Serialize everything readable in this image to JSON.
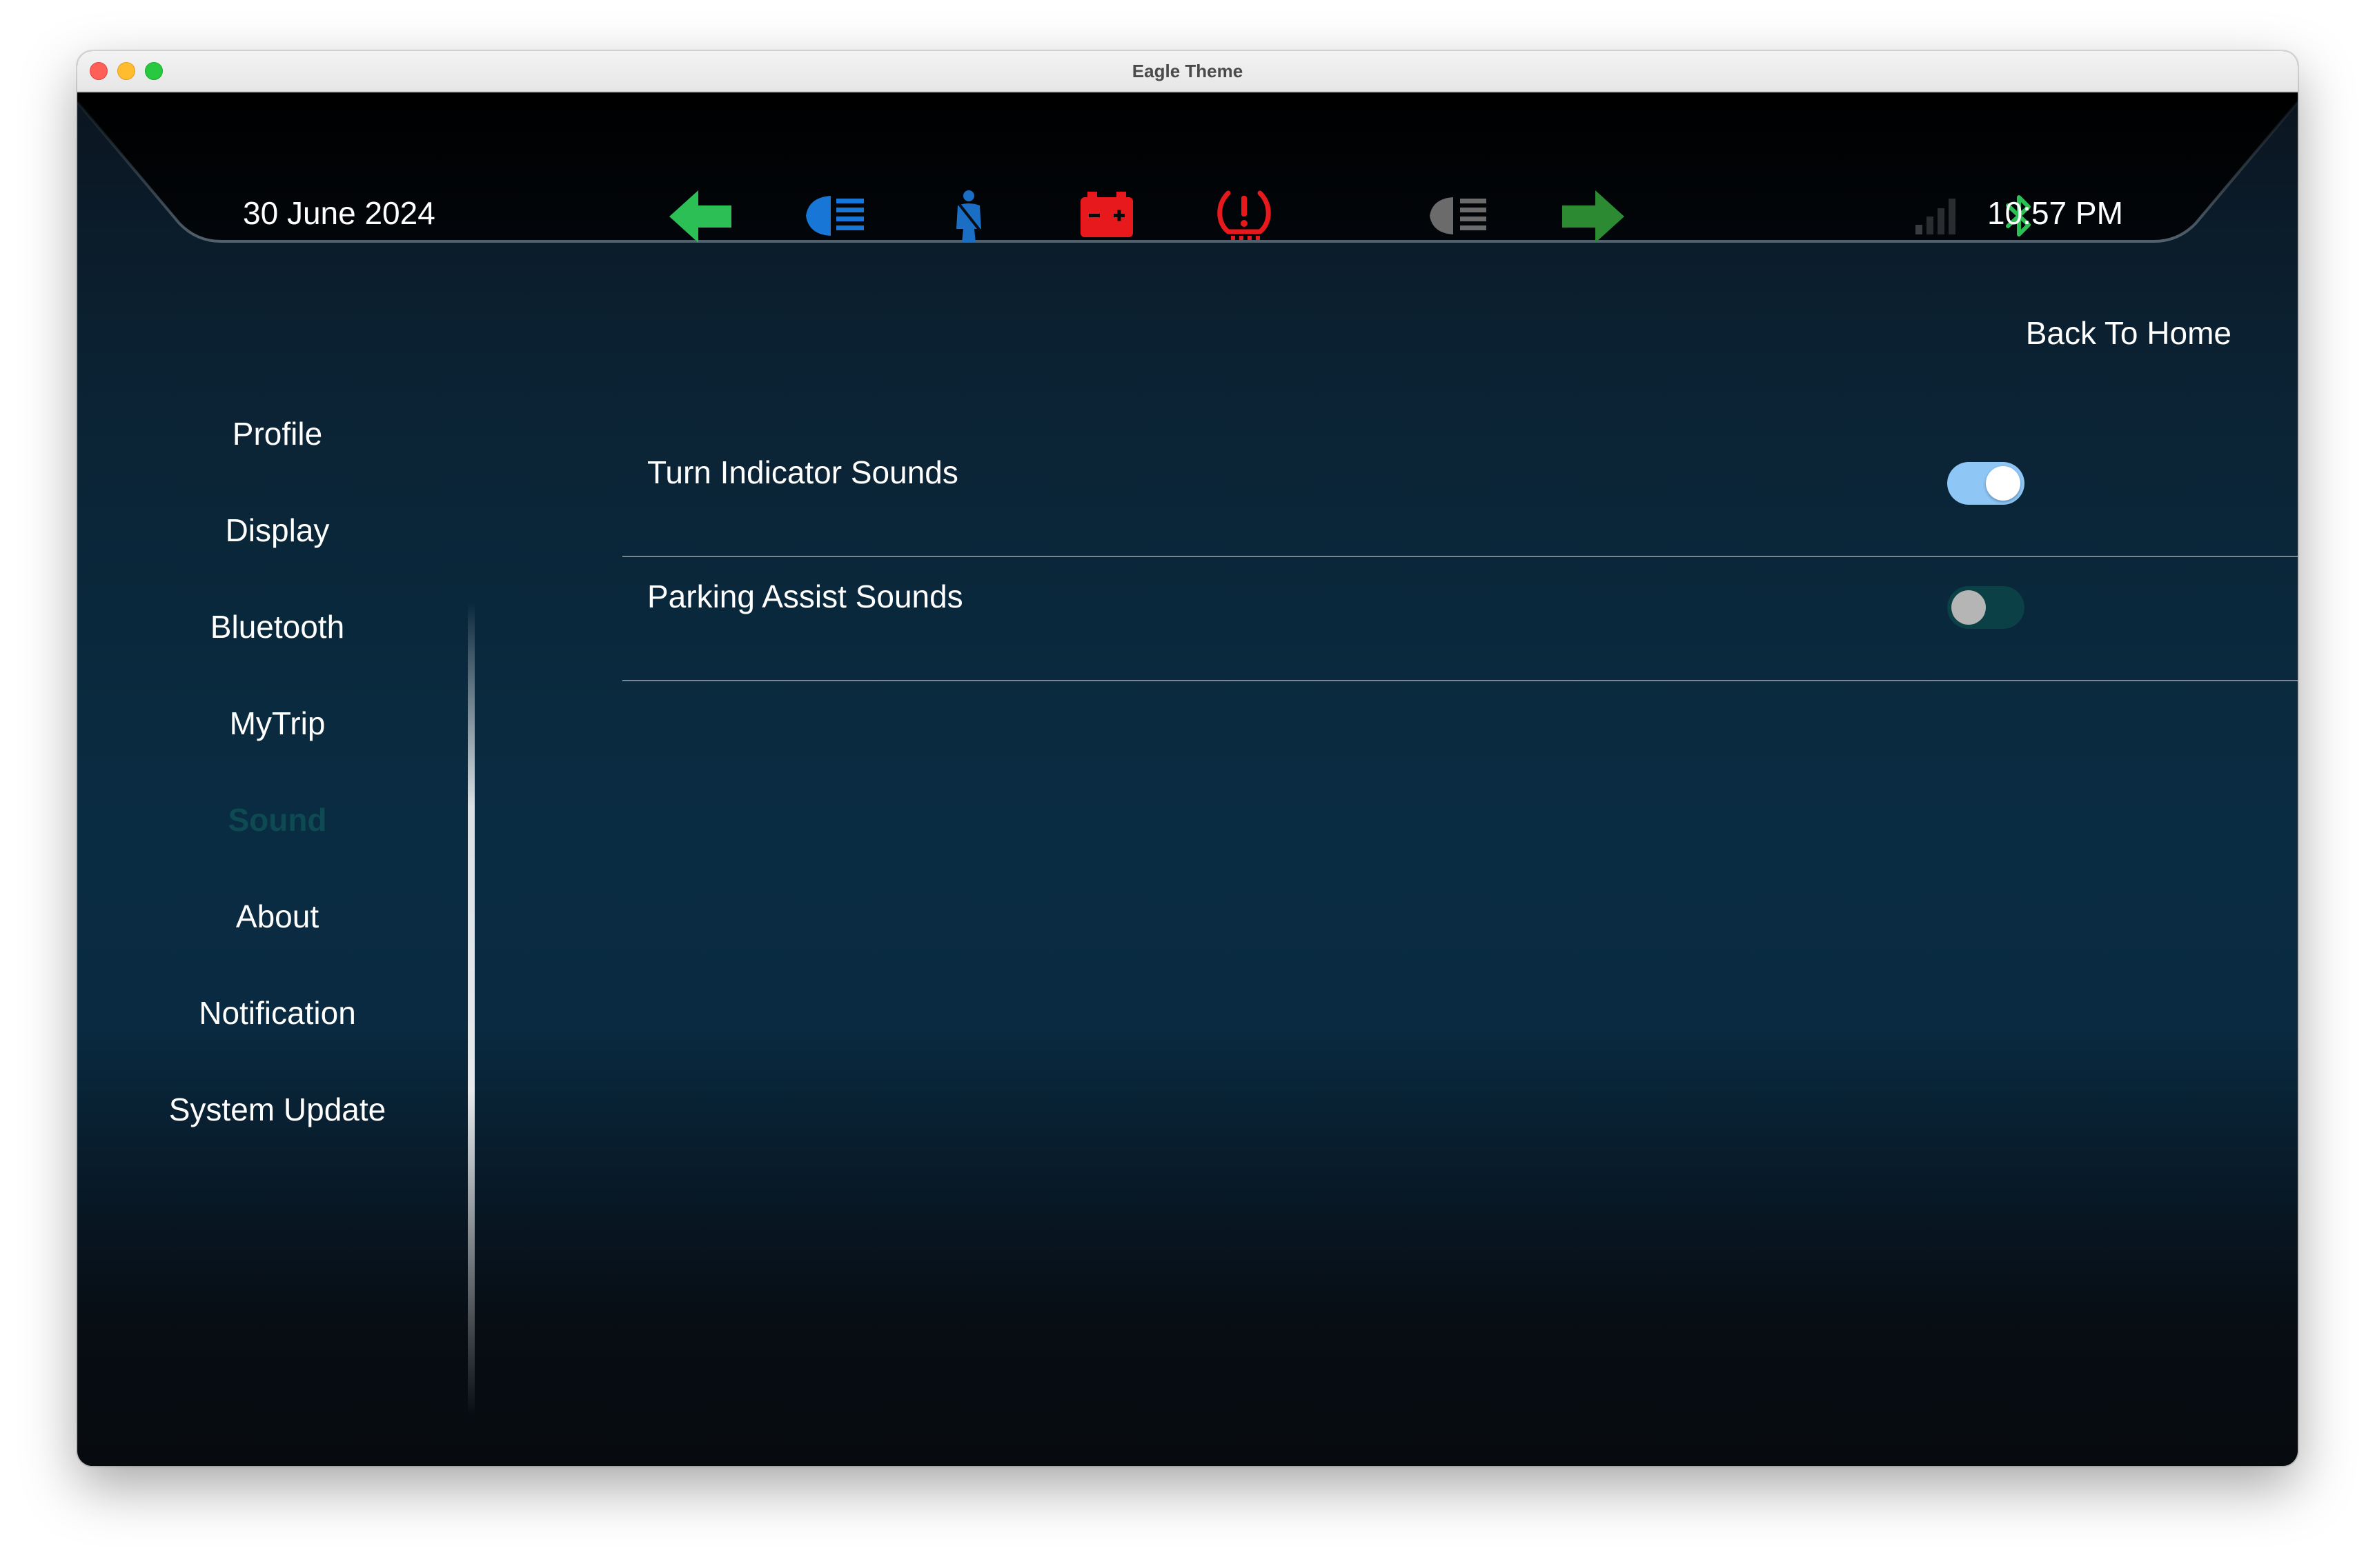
{
  "window": {
    "title": "Eagle Theme"
  },
  "header": {
    "date": "30 June 2024",
    "time": "10:57 PM",
    "indicators": [
      {
        "name": "left-turn-arrow-icon",
        "color": "#2cbf55"
      },
      {
        "name": "high-beam-icon",
        "color": "#1877d6"
      },
      {
        "name": "seatbelt-icon",
        "color": "#1a6fc4"
      },
      {
        "name": "battery-warning-icon",
        "color": "#e8191c"
      },
      {
        "name": "tire-pressure-warning-icon",
        "color": "#e8191c"
      },
      {
        "name": "low-beam-icon",
        "color": "#6b6b6b"
      },
      {
        "name": "right-turn-arrow-icon",
        "color": "#2c8a32"
      }
    ],
    "signal_icon": "signal-strength-icon",
    "bluetooth_icon": "bluetooth-icon",
    "bluetooth_color": "#2cbf55"
  },
  "sidebar": {
    "items": [
      {
        "label": "Profile"
      },
      {
        "label": "Display"
      },
      {
        "label": "Bluetooth"
      },
      {
        "label": "MyTrip"
      },
      {
        "label": "Sound",
        "active": true
      },
      {
        "label": "About"
      },
      {
        "label": "Notification"
      },
      {
        "label": "System Update"
      }
    ],
    "active_color": "#0e4a52"
  },
  "main": {
    "back_to_home": "Back To Home",
    "settings": [
      {
        "label": "Turn Indicator Sounds",
        "enabled": true
      },
      {
        "label": "Parking Assist Sounds",
        "enabled": false
      }
    ]
  }
}
